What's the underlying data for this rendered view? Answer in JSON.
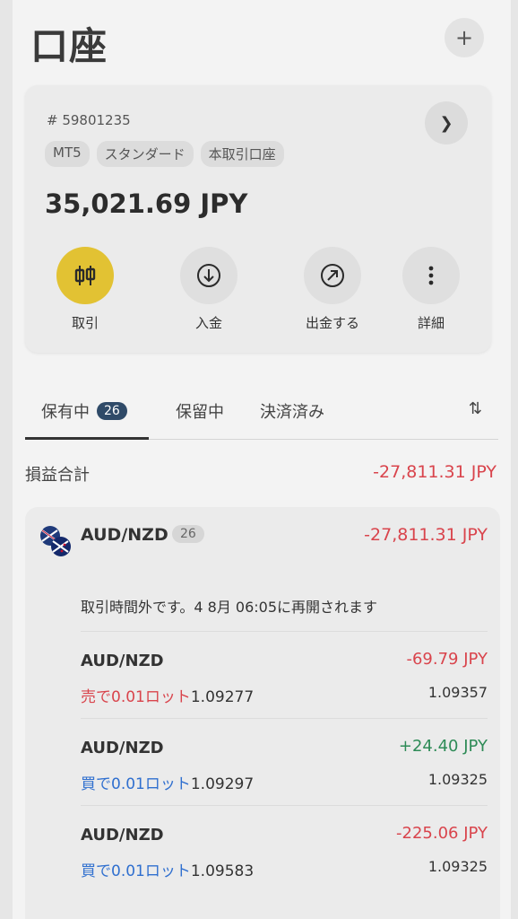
{
  "header": {
    "title": "口座",
    "add_icon": "plus-icon"
  },
  "account": {
    "number": "# 59801235",
    "tags": [
      "MT5",
      "スタンダード",
      "本取引口座"
    ],
    "balance": "35,021.69 JPY",
    "actions": [
      {
        "label": "取引",
        "icon": "candlestick-icon"
      },
      {
        "label": "入金",
        "icon": "arrow-down-circle-icon"
      },
      {
        "label": "出金する",
        "icon": "arrow-up-right-circle-icon"
      },
      {
        "label": "詳細",
        "icon": "more-vertical-icon"
      }
    ]
  },
  "tabs": [
    {
      "label": "保有中",
      "count": "26"
    },
    {
      "label": "保留中"
    },
    {
      "label": "決済済み"
    }
  ],
  "summary": {
    "label": "損益合計",
    "value": "-27,811.31 JPY"
  },
  "group": {
    "pair": "AUD/NZD",
    "count": "26",
    "pl": "-27,811.31 JPY",
    "notice": "取引時間外です。4 8月 06:05に再開されます",
    "positions": [
      {
        "symbol": "AUD/NZD",
        "pl": "-69.79 JPY",
        "side": "売で",
        "lot": "0.01ロット",
        "open": "1.09277",
        "current": "1.09357"
      },
      {
        "symbol": "AUD/NZD",
        "pl": "+24.40 JPY",
        "side": "買で",
        "lot": "0.01ロット",
        "open": "1.09297",
        "current": "1.09325"
      },
      {
        "symbol": "AUD/NZD",
        "pl": "-225.06 JPY",
        "side": "買で",
        "lot": "0.01ロット",
        "open": "1.09583",
        "current": "1.09325"
      }
    ]
  },
  "colors": {
    "loss": "#d9444c",
    "profit": "#2e8b57",
    "buy": "#2f6fcf",
    "sell": "#d9444c",
    "accent": "#e2c233",
    "badge": "#2f4a68"
  }
}
